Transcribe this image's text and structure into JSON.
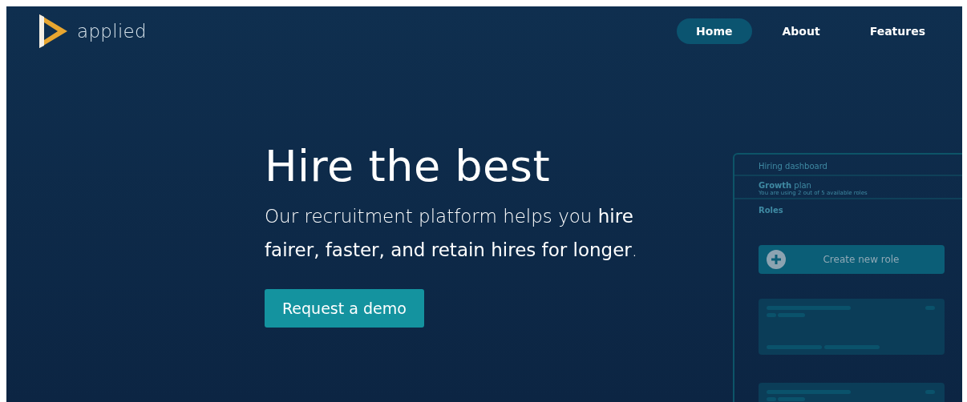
{
  "logo": {
    "text": "applied"
  },
  "nav": [
    {
      "label": "Home",
      "selected": true
    },
    {
      "label": "About",
      "selected": false
    },
    {
      "label": "Features",
      "selected": false
    }
  ],
  "hero": {
    "title": "Hire the best",
    "subtitle": "Our recruitment platform helps you **hire fairer, faster, and retain hires for longer**.",
    "button": "Request a demo"
  },
  "dashboard": {
    "title": "Hiring dashboard",
    "plan": "**Growth** plan",
    "plan_note": "You are using 2 out of 5 available roles",
    "section": "Roles",
    "create_button": "Create new role"
  }
}
